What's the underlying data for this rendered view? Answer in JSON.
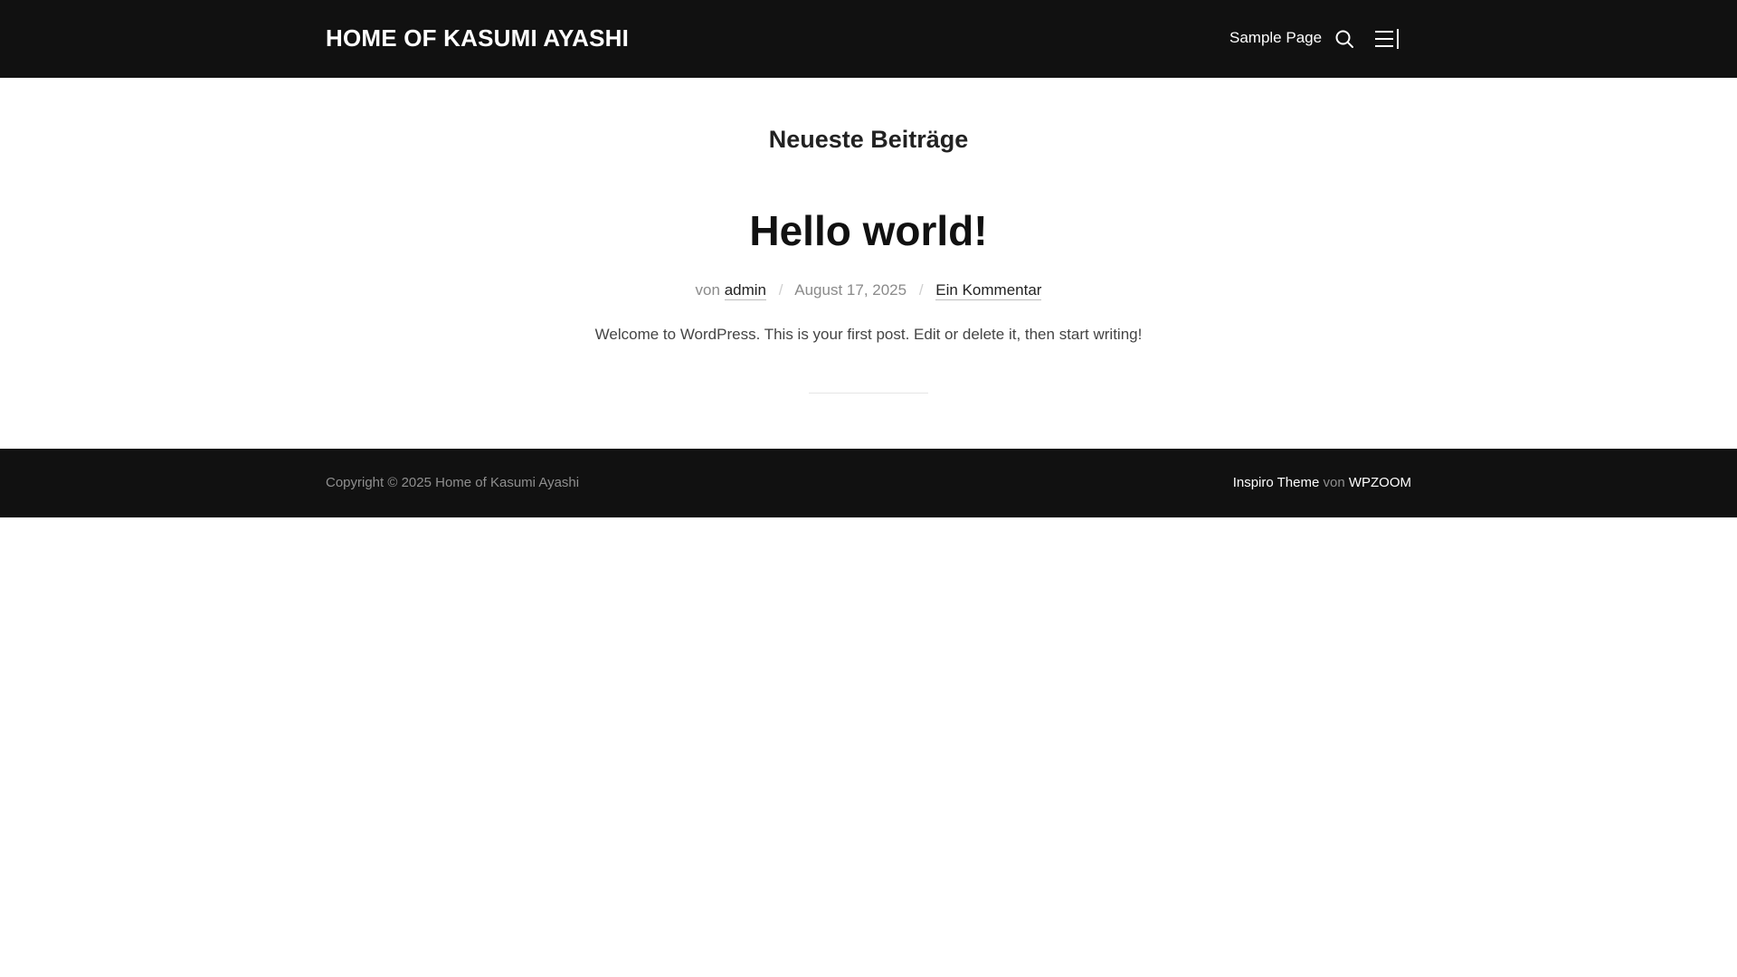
{
  "header": {
    "site_title": "HOME OF KASUMI AYASHI",
    "nav": [
      {
        "label": "Sample Page"
      }
    ],
    "icons": {
      "search": "search-icon",
      "menu": "sidebar-toggle-icon"
    }
  },
  "main": {
    "heading": "Neueste Beiträge",
    "post": {
      "title": "Hello world!",
      "meta": {
        "by_prefix": "von",
        "author": "admin",
        "date": "August 17, 2025",
        "comments": "Ein Kommentar",
        "separator": "/"
      },
      "excerpt": "Welcome to WordPress. This is your first post. Edit or delete it, then start writing!"
    }
  },
  "footer": {
    "copyright": "Copyright © 2025 Home of Kasumi Ayashi",
    "credits": {
      "theme": "Inspiro Theme",
      "by": "von",
      "vendor": "WPZOOM"
    }
  },
  "colors": {
    "header_bg": "#111111",
    "footer_bg": "#111111",
    "text_dark": "#111111",
    "text_muted": "#8a8a8a"
  }
}
